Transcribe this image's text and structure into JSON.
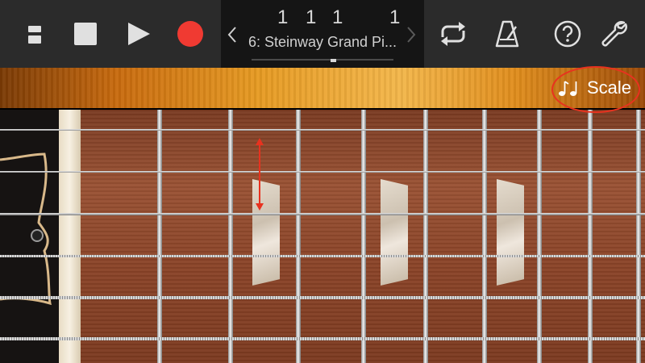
{
  "toolbar": {
    "buttons": [
      {
        "name": "browser-button",
        "icon": "track-view-icon"
      },
      {
        "name": "stop-button",
        "icon": "stop-icon"
      },
      {
        "name": "play-button",
        "icon": "play-icon"
      },
      {
        "name": "record-button",
        "icon": "record-icon"
      },
      {
        "name": "cycle-button",
        "icon": "loop-icon"
      },
      {
        "name": "metronome-button",
        "icon": "metronome-icon"
      },
      {
        "name": "help-button",
        "icon": "help-icon"
      },
      {
        "name": "settings-button",
        "icon": "wrench-icon"
      }
    ],
    "colors": {
      "record": "#f03a32",
      "bar": "#2b2b2b",
      "lcd": "#151515",
      "icon": "#e0e0e0"
    }
  },
  "lcd": {
    "bar": "1",
    "beat": "1",
    "division": "1",
    "tick": "1",
    "instrument_name": "6: Steinway Grand Pi..."
  },
  "scale_button": {
    "label": "Scale",
    "icon": "music-notes-icon"
  },
  "annotation": {
    "color": "#e8321f",
    "highlight": "scale-button",
    "arrow": "vertical-double-arrow"
  }
}
